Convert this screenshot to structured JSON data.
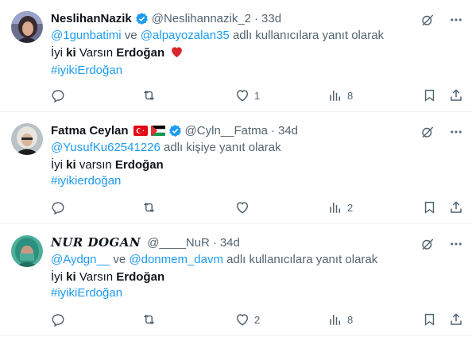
{
  "colors": {
    "link": "#1d9bf0",
    "muted": "#536471",
    "text": "#0f1419",
    "verified": "#1d9bf0",
    "heart": "#d9252d"
  },
  "tweets": [
    {
      "display_name": "NeslihanNazik",
      "handle": "@Neslihannazik_2",
      "separator": "·",
      "time": "33d",
      "replying": {
        "mention1": "@1gunbatimi",
        "joiner": " ve ",
        "mention2": "@alpayozalan35",
        "suffix": " adlı kullanıcılara yanıt olarak"
      },
      "text": {
        "p1": "İyi ",
        "p2": "ki",
        "p3": " Varsın ",
        "p4": "Erdoğan"
      },
      "emoji": "heart-emoji",
      "hashtag": "#iyikiErdoğan",
      "counts": {
        "replies": "",
        "retweets": "",
        "likes": "1",
        "views": "8"
      }
    },
    {
      "display_name": "Fatma Ceylan",
      "flags": [
        "turkey-flag",
        "palestine-flag"
      ],
      "handle": "@Cyln__Fatma",
      "separator": "·",
      "time": "34d",
      "replying": {
        "mention1": "@YusufKu62541226",
        "suffix": " adlı kişiye yanıt olarak"
      },
      "text": {
        "p1": "İyi ",
        "p2": "ki",
        "p3": " varsın ",
        "p4": "Erdoğan"
      },
      "hashtag": "#iyikierdoğan",
      "counts": {
        "replies": "",
        "retweets": "",
        "likes": "",
        "views": "2"
      }
    },
    {
      "display_name": "NUR DOGAN",
      "handle": "@____NuR",
      "separator": "·",
      "time": "34d",
      "replying": {
        "mention1": "@Aydgn__",
        "joiner": " ve ",
        "mention2": "@donmem_davm",
        "suffix": " adlı kullanıcılara yanıt olarak"
      },
      "text": {
        "p1": "İyi ",
        "p2": "ki",
        "p3": " Varsın ",
        "p4": "Erdoğan"
      },
      "hashtag": "#iyikiErdoğan",
      "counts": {
        "replies": "",
        "retweets": "",
        "likes": "2",
        "views": "8"
      }
    }
  ]
}
